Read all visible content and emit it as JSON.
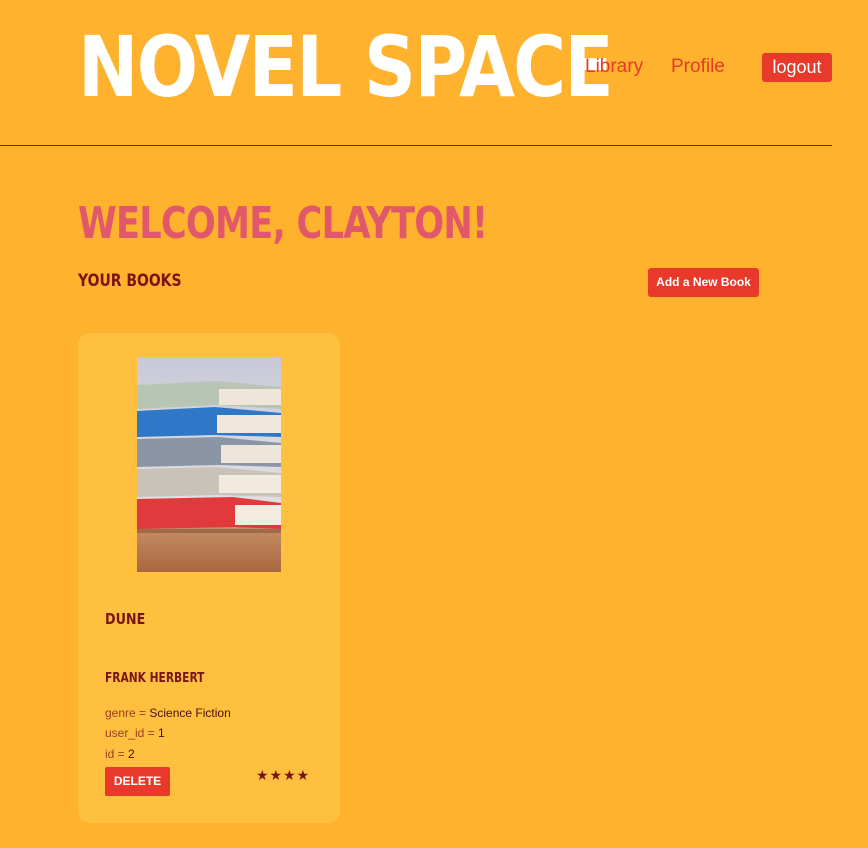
{
  "header": {
    "logo": "NOVEL SPACE",
    "nav": {
      "library": "Library",
      "profile": "Profile",
      "logout": "logout"
    }
  },
  "main": {
    "welcome": "Welcome, Clayton!",
    "section_title": "Your Books",
    "add_button": "Add a New Book"
  },
  "book": {
    "title": "Dune",
    "author": "Frank Herbert",
    "genre_label": "genre = ",
    "genre": "Science Fiction",
    "user_id_label": "user_id = ",
    "user_id": "1",
    "id_label": "id = ",
    "id": "2",
    "delete_label": "DELETE",
    "rating": 4,
    "rating_stars": "★★★★"
  },
  "colors": {
    "background": "#ffb22e",
    "card": "#ffc03f",
    "accent_red": "#e8392b",
    "welcome_pink": "#e0586a",
    "dark_maroon": "#7a1416"
  }
}
